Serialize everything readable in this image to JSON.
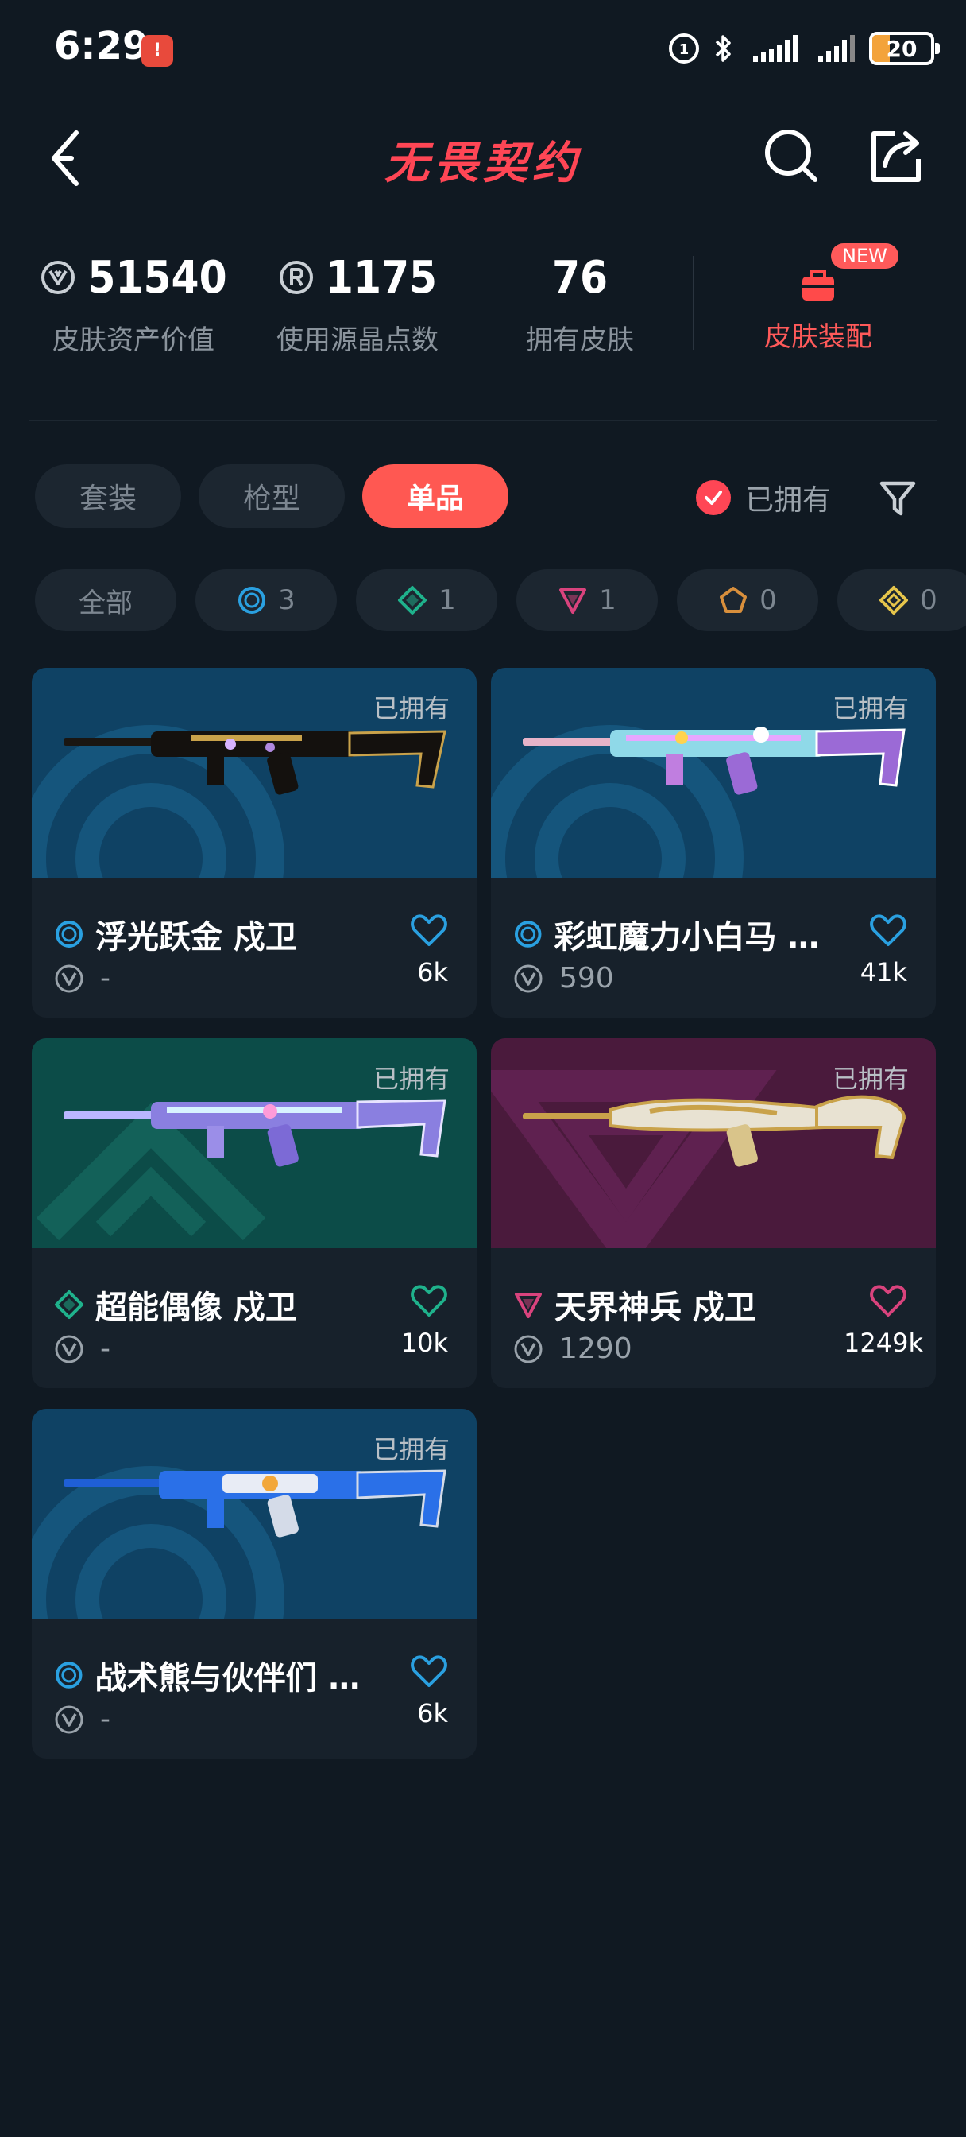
{
  "status_bar": {
    "time": "6:29",
    "alert_badge": "!",
    "battery": "20"
  },
  "header": {
    "title": "无畏契约"
  },
  "stats": {
    "asset_value": "51540",
    "asset_value_label": "皮肤资产价值",
    "radianite": "1175",
    "radianite_label": "使用源晶点数",
    "skins_owned": "76",
    "skins_owned_label": "拥有皮肤",
    "equip_label": "皮肤装配",
    "equip_badge": "NEW"
  },
  "tabs": [
    {
      "label": "套装"
    },
    {
      "label": "枪型"
    },
    {
      "label": "单品"
    }
  ],
  "owned_filter": {
    "label": "已拥有"
  },
  "rarity_chips": [
    {
      "label": "全部"
    },
    {
      "label": "3"
    },
    {
      "label": "1"
    },
    {
      "label": "1"
    },
    {
      "label": "0"
    },
    {
      "label": "0"
    }
  ],
  "colors": {
    "accent": "#ff4655",
    "select": "#2aa0e0",
    "deluxe": "#1fb28c",
    "premium": "#d9437d",
    "exclusive": "#d88f3c",
    "ultra": "#e6c54b"
  },
  "cards": [
    {
      "owned": "已拥有",
      "name": "浮光跃金 戍卫",
      "price": "-",
      "likes": "6k",
      "tier_icon": "select-tier-icon"
    },
    {
      "owned": "已拥有",
      "name": "彩虹魔力小白马 戍卫",
      "price": "590",
      "likes": "41k",
      "tier_icon": "select-tier-icon"
    },
    {
      "owned": "已拥有",
      "name": "超能偶像 戍卫",
      "price": "-",
      "likes": "10k",
      "tier_icon": "deluxe-tier-icon"
    },
    {
      "owned": "已拥有",
      "name": "天界神兵 戍卫",
      "price": "1290",
      "likes": "1249k",
      "tier_icon": "premium-tier-icon"
    },
    {
      "owned": "已拥有",
      "name": "战术熊与伙伴们 戍卫",
      "price": "-",
      "likes": "6k",
      "tier_icon": "select-tier-icon"
    }
  ]
}
